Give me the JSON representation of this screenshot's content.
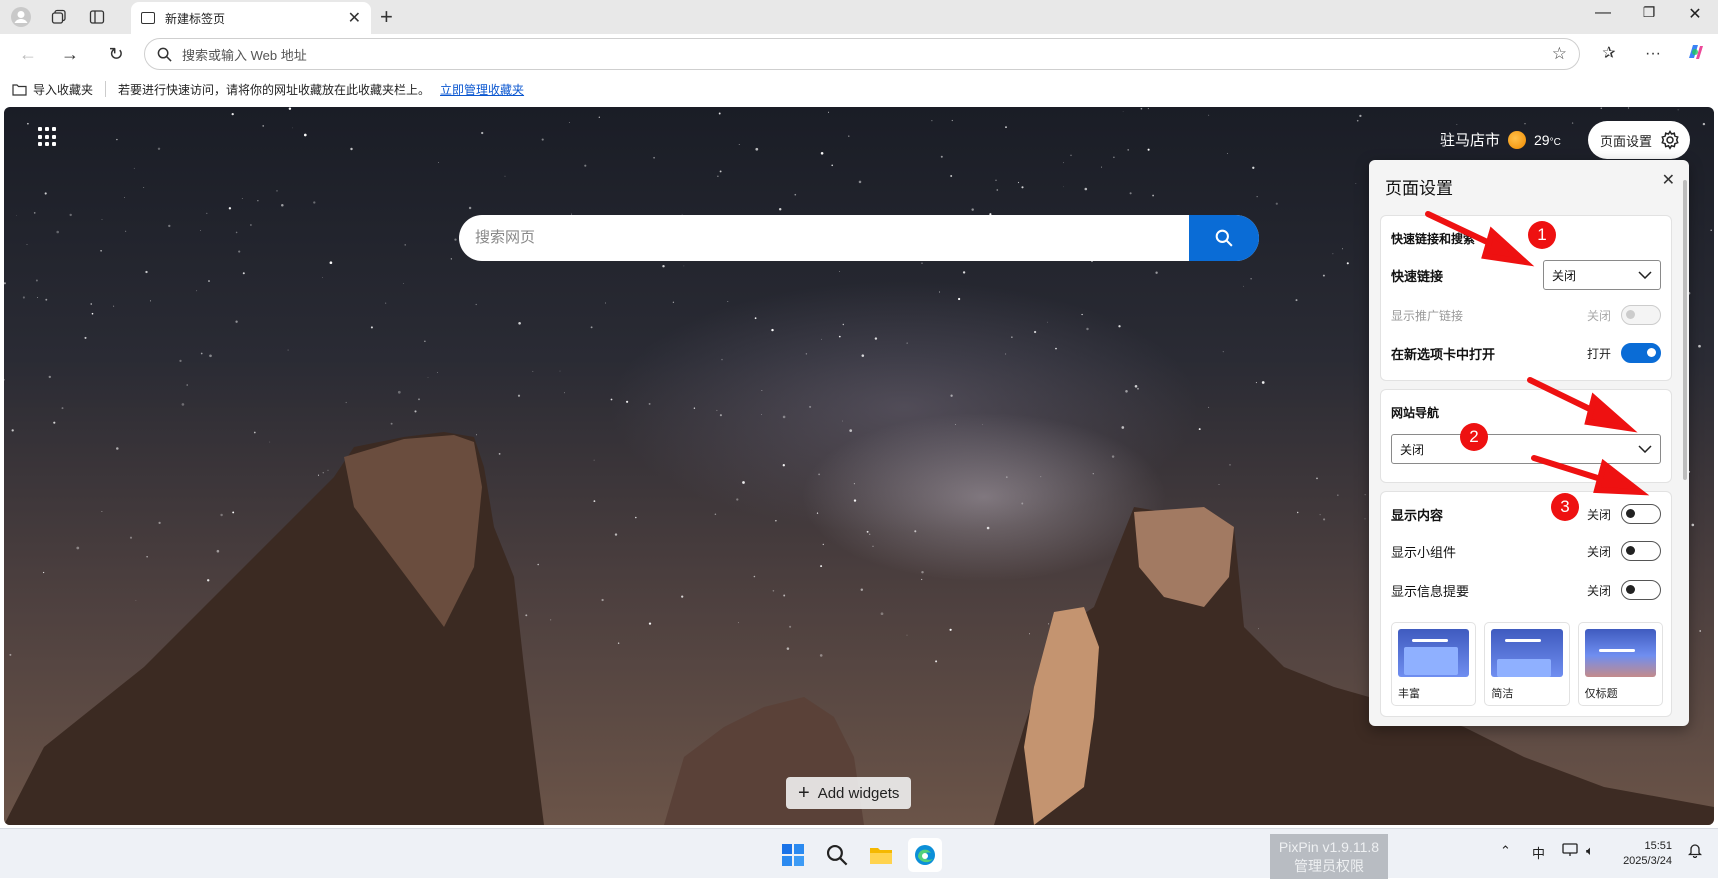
{
  "tab": {
    "title": "新建标签页"
  },
  "address": {
    "placeholder": "搜索或输入 Web 地址"
  },
  "favorites_bar": {
    "import_label": "导入收藏夹",
    "hint": "若要进行快速访问，请将你的网址收藏放在此收藏夹栏上。",
    "manage_link": "立即管理收藏夹"
  },
  "header": {
    "city": "驻马店市",
    "temperature": "29",
    "temp_unit": "°C",
    "page_settings_label": "页面设置"
  },
  "search": {
    "placeholder": "搜索网页"
  },
  "add_widgets_label": "Add widgets",
  "panel": {
    "title": "页面设置",
    "quick_links_section": "快速链接和搜索",
    "quick_links_label": "快速链接",
    "quick_links_value": "关闭",
    "promoted_links_label": "显示推广链接",
    "promoted_links_state": "关闭",
    "open_new_tab_label": "在新选项卡中打开",
    "open_new_tab_state": "打开",
    "site_nav_label": "网站导航",
    "site_nav_value": "关闭",
    "show_content_label": "显示内容",
    "show_content_state": "关闭",
    "show_widgets_label": "显示小组件",
    "show_widgets_state": "关闭",
    "show_info_label": "显示信息提要",
    "show_info_state": "关闭",
    "layouts": [
      {
        "name": "丰富"
      },
      {
        "name": "简洁"
      },
      {
        "name": "仅标题"
      }
    ]
  },
  "annotations": [
    "1",
    "2",
    "3"
  ],
  "taskbar": {
    "pixpin_line1": "PixPin v1.9.11.8",
    "pixpin_line2": "管理员权限",
    "ime": "中",
    "time": "15:51",
    "date": "2025/3/24"
  },
  "colors": {
    "accent": "#0a6cd6",
    "annotation": "#ee1111"
  }
}
